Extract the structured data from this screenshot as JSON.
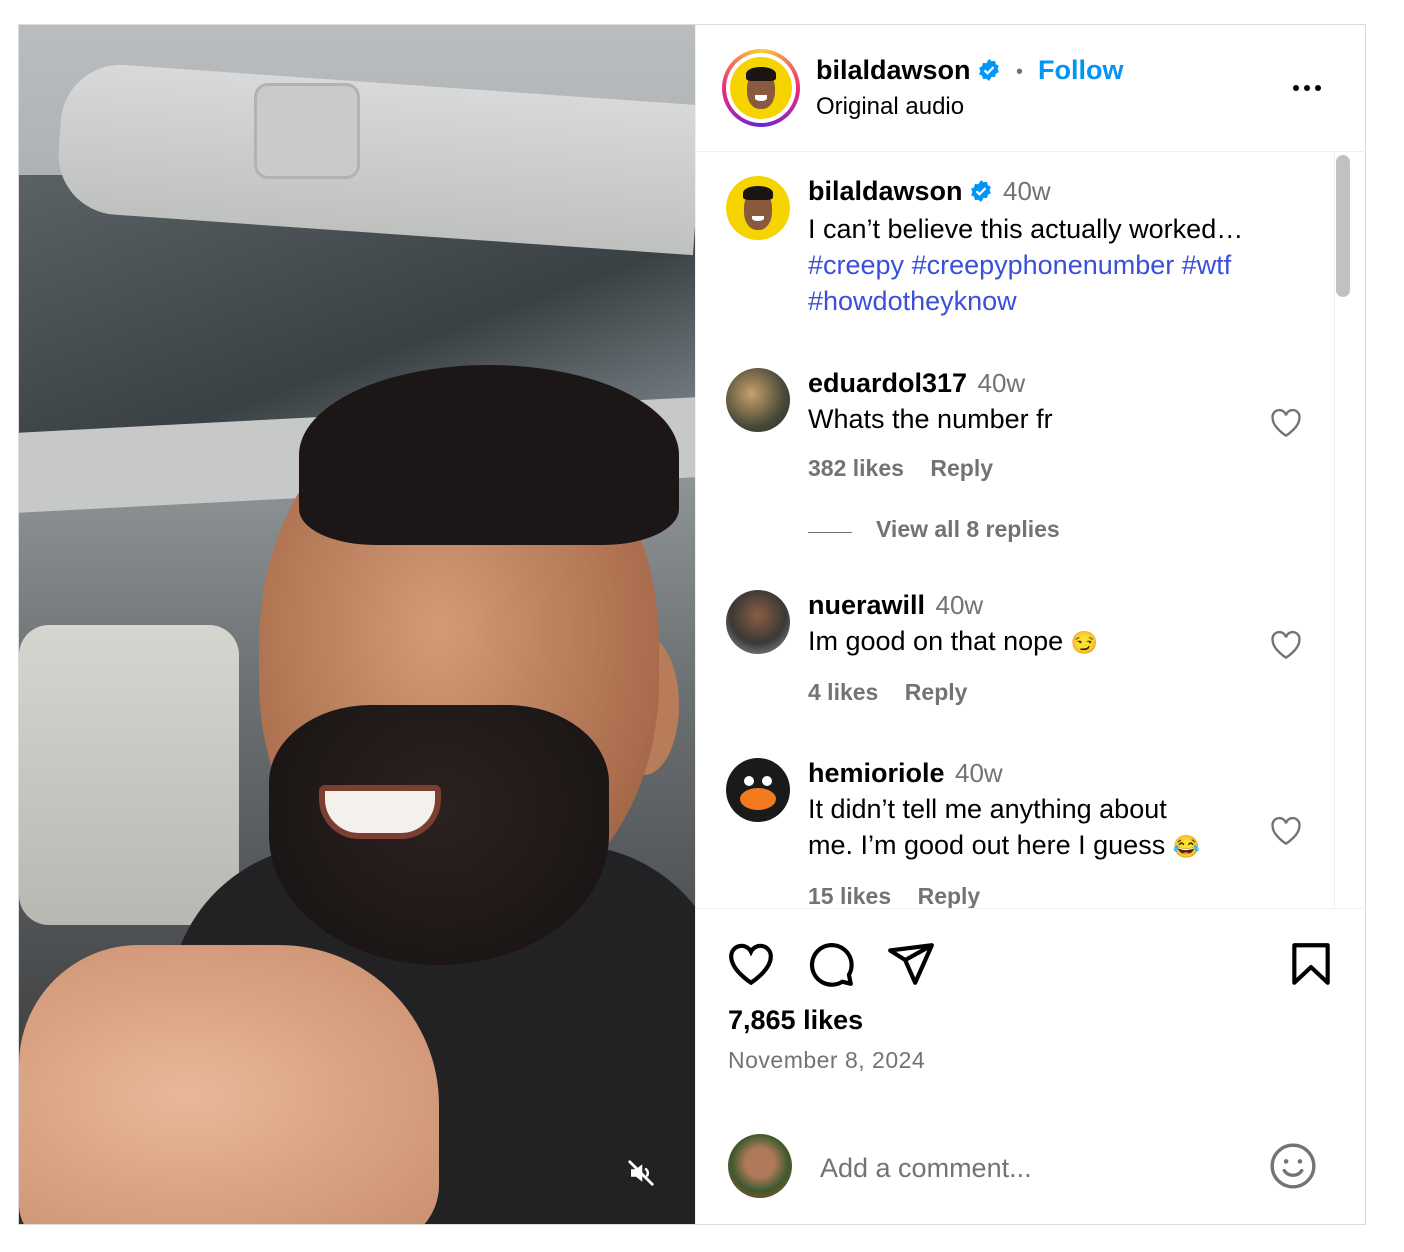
{
  "post": {
    "author": "bilaldawson",
    "follow_label": "Follow",
    "separator": "•",
    "audio_label": "Original audio"
  },
  "caption": {
    "author": "bilaldawson",
    "time": "40w",
    "text": "I can’t believe this actually worked…",
    "hashtags": [
      "#creepy",
      "#creepyphonenumber",
      "#wtf",
      "#howdotheyknow"
    ]
  },
  "comments": [
    {
      "author": "eduardol317",
      "time": "40w",
      "text": "Whats the number fr",
      "emoji": "",
      "likes": "382 likes",
      "reply": "Reply",
      "view_replies": "View all 8 replies"
    },
    {
      "author": "nuerawill",
      "time": "40w",
      "text": "Im good on that nope",
      "emoji": "😏",
      "likes": "4 likes",
      "reply": "Reply"
    },
    {
      "author": "hemioriole",
      "time": "40w",
      "text_line1": "It didn’t tell me anything about",
      "text_line2": "me. I’m good out here I guess",
      "emoji": "😂",
      "likes": "15 likes",
      "reply": "Reply"
    }
  ],
  "footer": {
    "likes": "7,865 likes",
    "date": "November 8, 2024",
    "comment_placeholder": "Add a comment..."
  },
  "colors": {
    "link": "#0095f6",
    "hashtag": "#3a50d8",
    "muted": "#737373",
    "verified": "#0095f6"
  },
  "icons": [
    "verified-badge-icon",
    "more-options-icon",
    "heart-icon",
    "comment-icon",
    "share-icon",
    "bookmark-icon",
    "emoji-icon",
    "mute-icon"
  ]
}
